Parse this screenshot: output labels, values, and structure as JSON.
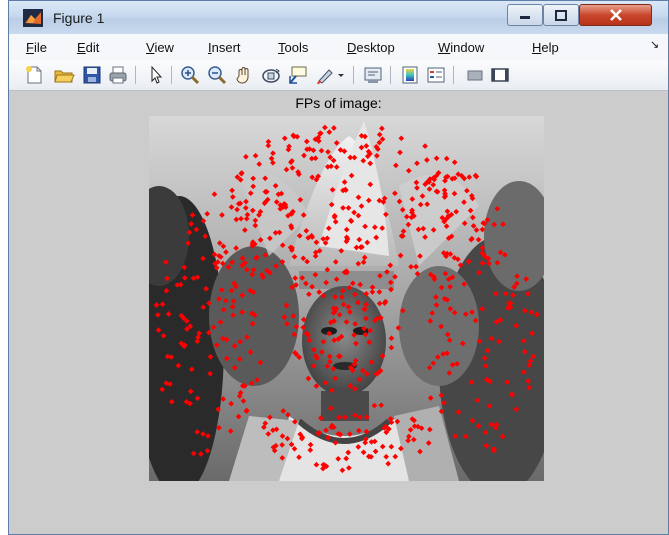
{
  "window": {
    "title": "Figure 1",
    "buttons": {
      "minimize": "minimize",
      "maximize": "maximize",
      "close": "close"
    }
  },
  "menu": [
    {
      "first": "F",
      "rest": "ile"
    },
    {
      "first": "E",
      "rest": "dit"
    },
    {
      "first": "V",
      "rest": "iew"
    },
    {
      "first": "I",
      "rest": "nsert"
    },
    {
      "first": "T",
      "rest": "ools"
    },
    {
      "first": "D",
      "rest": "esktop"
    },
    {
      "first": "W",
      "rest": "indow"
    },
    {
      "first": "H",
      "rest": "elp"
    }
  ],
  "toolbar": {
    "tools": [
      "new-figure",
      "open-file",
      "save-figure",
      "print-figure",
      "edit-plot",
      "zoom-in",
      "zoom-out",
      "pan",
      "rotate-3d",
      "data-cursor",
      "brush",
      "brush-dropdown",
      "link-plot",
      "insert-colorbar",
      "insert-legend",
      "hide-plot-tools",
      "show-plot-tools"
    ]
  },
  "figure": {
    "title": "FPs of image:",
    "marker_color": "#ff0000",
    "image": "grayscale photograph of a person with a feathered headdress in a crowd, overlaid with red feature-point markers"
  }
}
